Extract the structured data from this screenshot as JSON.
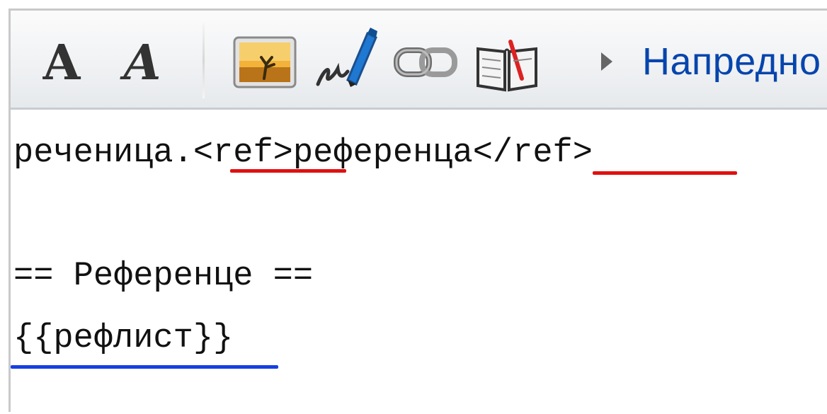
{
  "toolbar": {
    "bold_icon": "bold-icon",
    "bold_glyph": "A",
    "italic_icon": "italic-icon",
    "italic_glyph": "A",
    "image_icon": "image-icon",
    "signature_icon": "signature-pen-icon",
    "link_icon": "link-chain-icon",
    "reference_icon": "reference-book-icon",
    "advanced_arrow_icon": "triangle-right-icon",
    "advanced_label": "Напредно"
  },
  "editor": {
    "line1": "реченица.<ref>референца</ref>",
    "line2": "== Референце ==",
    "line3": "{{рефлист}}"
  },
  "colors": {
    "ref_tag_underline": "#e01010",
    "reflist_underline": "#1540e0",
    "advanced_link": "#0645ad"
  }
}
